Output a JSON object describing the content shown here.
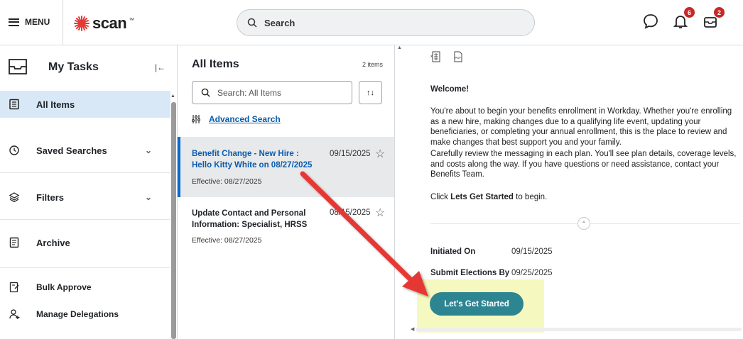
{
  "topbar": {
    "menu_label": "MENU",
    "logo_text": "scan",
    "logo_mark": "™",
    "search_placeholder": "Search",
    "notifications_count": "6",
    "inbox_count": "2"
  },
  "sidebar": {
    "title": "My Tasks",
    "items": [
      {
        "label": "All Items",
        "icon": "list-icon",
        "active": true
      },
      {
        "label": "Saved Searches",
        "icon": "clock-icon",
        "expandable": true
      },
      {
        "label": "Filters",
        "icon": "layers-icon",
        "expandable": true
      },
      {
        "label": "Archive",
        "icon": "archive-icon"
      },
      {
        "label": "Bulk Approve",
        "icon": "approve-icon"
      },
      {
        "label": "Manage Delegations",
        "icon": "delegation-icon"
      }
    ]
  },
  "middle": {
    "title": "All Items",
    "count": "2 items",
    "search_placeholder": "Search: All Items",
    "advanced_search": "Advanced Search",
    "tasks": [
      {
        "title": "Benefit Change - New Hire : Hello Kitty White on 08/27/2025",
        "date": "09/15/2025",
        "effective": "Effective: 08/27/2025"
      },
      {
        "title": "Update Contact and Personal Information: Specialist, HRSS",
        "date": "08/15/2025",
        "effective": "Effective: 08/27/2025"
      }
    ]
  },
  "detail": {
    "welcome_heading": "Welcome!",
    "para1": "You're about to begin your benefits enrollment in Workday. Whether you're enrolling as a new hire, making changes due to a qualifying life event, updating your beneficiaries, or completing your annual enrollment, this is the place to review and make changes that best support you and your family.",
    "para2": "Carefully review the messaging in each plan. You'll see plan details, coverage levels, and costs along the way. If you have questions or need assistance, contact your Benefits Team.",
    "click_prefix": "Click ",
    "click_bold": "Lets Get Started",
    "click_suffix": " to begin.",
    "initiated_label": "Initiated On",
    "initiated_value": "09/15/2025",
    "submit_label": "Submit Elections By",
    "submit_value": "09/25/2025",
    "start_button": "Let's Get Started",
    "export_excel": "excel-icon",
    "export_pdf": "pdf-icon"
  },
  "colors": {
    "accent_blue": "#0b5cad",
    "selected_bg": "#d9e8f6",
    "button_teal": "#2e8592",
    "highlight_yellow": "#f6f9bf",
    "arrow_red": "#e53935",
    "badge_red": "#c62828"
  }
}
